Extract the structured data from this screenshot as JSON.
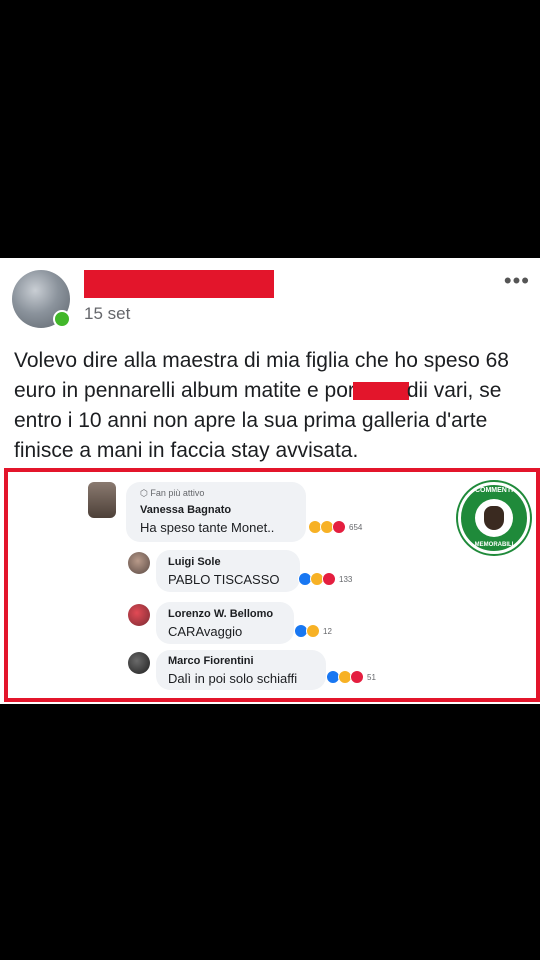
{
  "post": {
    "date": "15 set",
    "more": "•••",
    "text_part1": "Volevo dire alla maestra di mia figlia che ho speso 68 euro in pennarelli album matite e por",
    "text_part2": "dii vari, se entro i 10 anni non apre la sua prima galleria d'arte finisce a mani in faccia stay avvisata."
  },
  "comments": [
    {
      "badge": "Fan più attivo",
      "name": "Vanessa Bagnato",
      "text": "Ha speso tante Monet..",
      "count": "654"
    },
    {
      "name": "Luigi Sole",
      "text": "PABLO TISCASSO",
      "count": "133"
    },
    {
      "name": "Lorenzo W. Bellomo",
      "text": "CARAvaggio",
      "count": "12"
    },
    {
      "name": "Marco Fiorentini",
      "text": "Dalì in poi solo schiaffi",
      "count": "51"
    }
  ],
  "logo": {
    "top": "COMMENTI",
    "bottom": "MEMORABILI"
  },
  "colors": {
    "redaction": "#e3152b",
    "frame": "#e3152b",
    "online": "#42b72a",
    "like": "#1877f2",
    "haha": "#f7b125",
    "love": "#e41e3f"
  }
}
